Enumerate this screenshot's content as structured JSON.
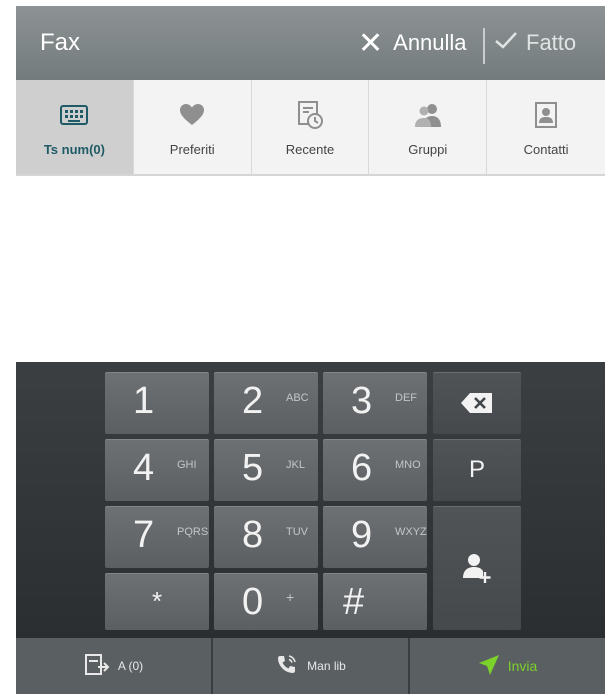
{
  "header": {
    "title": "Fax",
    "cancel_label": "Annulla",
    "done_label": "Fatto"
  },
  "tabs": [
    {
      "label": "Ts num(0)",
      "icon": "keyboard-icon",
      "active": true
    },
    {
      "label": "Preferiti",
      "icon": "heart-icon",
      "active": false
    },
    {
      "label": "Recente",
      "icon": "recent-log-icon",
      "active": false
    },
    {
      "label": "Gruppi",
      "icon": "group-icon",
      "active": false
    },
    {
      "label": "Contatti",
      "icon": "contact-card-icon",
      "active": false
    }
  ],
  "keypad": {
    "keys": [
      {
        "digit": "1",
        "letters": ""
      },
      {
        "digit": "2",
        "letters": "ABC"
      },
      {
        "digit": "3",
        "letters": "DEF"
      },
      {
        "digit": "4",
        "letters": "GHI"
      },
      {
        "digit": "5",
        "letters": "JKL"
      },
      {
        "digit": "6",
        "letters": "MNO"
      },
      {
        "digit": "7",
        "letters": "PQRS"
      },
      {
        "digit": "8",
        "letters": "TUV"
      },
      {
        "digit": "9",
        "letters": "WXYZ"
      },
      {
        "digit": "*",
        "letters": ""
      },
      {
        "digit": "0",
        "letters": "+"
      },
      {
        "digit": "#",
        "letters": ""
      }
    ],
    "pause_label": "P"
  },
  "bottom": {
    "recipients_label": "A (0)",
    "manual_label": "Man lib",
    "send_label": "Invia"
  },
  "colors": {
    "accent_send": "#7cd12b",
    "title_bar": "#7f8586",
    "active_tab_label": "#1f5b66"
  }
}
